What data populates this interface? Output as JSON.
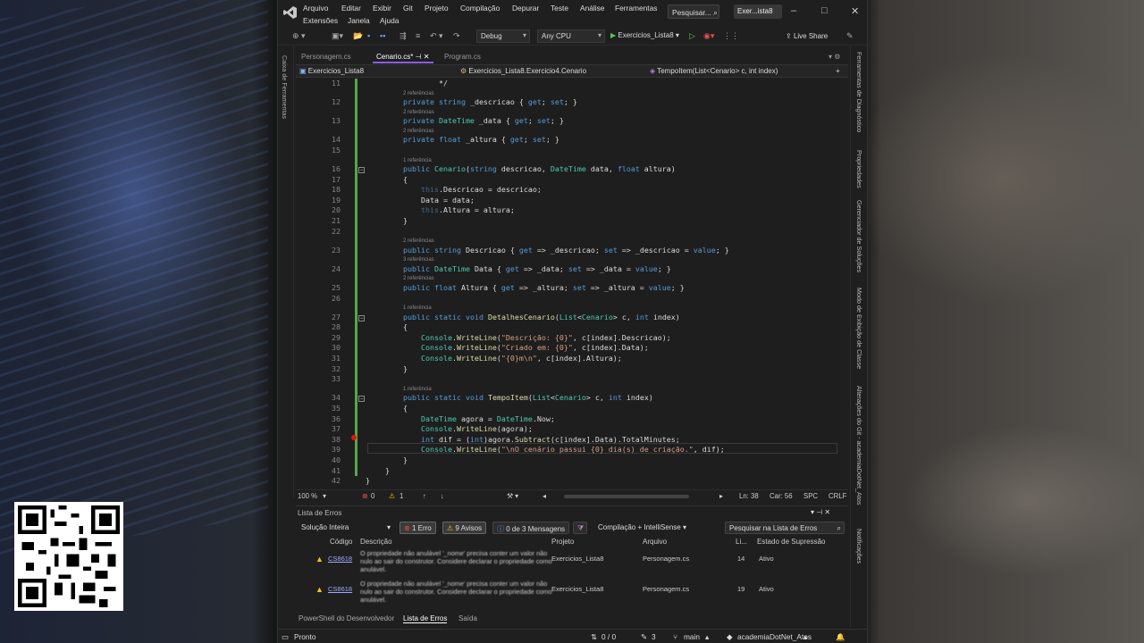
{
  "menu": [
    "Arquivo",
    "Editar",
    "Exibir",
    "Git",
    "Projeto",
    "Compilação",
    "Depurar",
    "Teste",
    "Análise",
    "Ferramentas",
    "Extensões",
    "Janela",
    "Ajuda"
  ],
  "search": {
    "label": "Pesquisar..."
  },
  "project_chip": "Exer...ista8",
  "toolbar": {
    "config": "Debug",
    "platform": "Any CPU",
    "run_label": "Exercicios_Lista8",
    "live_share": "Live Share"
  },
  "tabs": [
    {
      "label": "Personagem.cs"
    },
    {
      "label": "Cenario.cs*"
    },
    {
      "label": "Program.cs"
    }
  ],
  "nav": {
    "project": "Exercicios_Lista8",
    "class": "Exercicios_Lista8.Exercicio4.Cenario",
    "member": "TempoItem(List<Cenario> c, int index)"
  },
  "left_tool": "Caixa de Ferramentas",
  "right_tools": [
    "Ferramentas de Diagnóstico",
    "Propriedades",
    "Gerenciador de Soluções",
    "Modo de Exibição de Classe",
    "Alterações do Git - academiaDotNet_Atos",
    "Notificações"
  ],
  "code": {
    "lines": [
      {
        "n": "11",
        "text": "        */"
      },
      {
        "n": "12",
        "hint": "2 referências",
        "text": "private string _descricao { get; set; }"
      },
      {
        "n": "13",
        "hint": "2 referências",
        "text": "private DateTime _data { get; set; }"
      },
      {
        "n": "14",
        "hint": "2 referências",
        "text": "private float _altura { get; set; }"
      },
      {
        "n": "15",
        "text": ""
      },
      {
        "n": "16",
        "hint": "1 referência",
        "text": "public Cenario(string descricao, DateTime data, float altura)"
      },
      {
        "n": "17",
        "text": "{"
      },
      {
        "n": "18",
        "text": "    this.Descricao = descricao;"
      },
      {
        "n": "19",
        "text": "    Data = data;"
      },
      {
        "n": "20",
        "text": "    this.Altura = altura;"
      },
      {
        "n": "21",
        "text": "}"
      },
      {
        "n": "22",
        "text": ""
      },
      {
        "n": "23",
        "hint": "2 referências",
        "text": "public string Descricao { get => _descricao; set => _descricao = value; }"
      },
      {
        "n": "24",
        "hint": "3 referências",
        "text": "public DateTime Data { get => _data; set => _data = value; }"
      },
      {
        "n": "25",
        "hint": "2 referências",
        "text": "public float Altura { get => _altura; set => _altura = value; }"
      },
      {
        "n": "26",
        "text": ""
      },
      {
        "n": "27",
        "hint": "1 referência",
        "text": "public static void DetalhesCenario(List<Cenario> c, int index)"
      },
      {
        "n": "28",
        "text": "{"
      },
      {
        "n": "29",
        "text": "    Console.WriteLine(\"Descrição: {0}\", c[index].Descricao);"
      },
      {
        "n": "30",
        "text": "    Console.WriteLine(\"Criado em: {0}\", c[index].Data);"
      },
      {
        "n": "31",
        "text": "    Console.WriteLine(\"{0}m\\n\", c[index].Altura);"
      },
      {
        "n": "32",
        "text": "}"
      },
      {
        "n": "33",
        "text": ""
      },
      {
        "n": "34",
        "hint": "1 referência",
        "text": "public static void TempoItem(List<Cenario> c, int index)"
      },
      {
        "n": "35",
        "text": "{"
      },
      {
        "n": "36",
        "text": "    DateTime agora = DateTime.Now;"
      },
      {
        "n": "37",
        "text": "    Console.WriteLine(agora);"
      },
      {
        "n": "38",
        "text": "    int dif = (int)agora.Subtract(c[index].Data).TotalMinutes;"
      },
      {
        "n": "39",
        "text": "    Console.WriteLine(\"\\nO cenário passui {0} dia(s) de criação.\", dif);"
      },
      {
        "n": "40",
        "text": "}"
      },
      {
        "n": "41",
        "text": "}"
      },
      {
        "n": "42",
        "text": "}"
      }
    ]
  },
  "editor_status": {
    "zoom": "100 %",
    "errors": "0",
    "warnings": "1",
    "line": "Ln: 38",
    "col": "Car: 56",
    "spc": "SPC",
    "crlf": "CRLF"
  },
  "errpanel": {
    "title": "Lista de Erros",
    "scope": "Solução Inteira",
    "errors": "1 Erro",
    "warnings": "9 Avisos",
    "messages": "0 de 3 Mensagens",
    "build": "Compilação + IntelliSense",
    "search": "Pesquisar na Lista de Erros",
    "columns": [
      "Código",
      "Descrição",
      "Projeto",
      "Arquivo",
      "Li...",
      "Estado de Supressão"
    ],
    "rows": [
      {
        "code": "CS8618",
        "desc": "O propriedade não anulável '_nome' precisa conter um valor não nulo ao sair do construtor. Considere declarar o propriedade como anulável.",
        "project": "Exercicios_Lista8",
        "file": "Personagem.cs",
        "line": "14",
        "state": "Ativo"
      },
      {
        "code": "CS8618",
        "desc": "O propriedade não anulável '_nome' precisa conter um valor não nulo ao sair do construtor. Considere declarar o propriedade como anulável.",
        "project": "Exercicios_Lista8",
        "file": "Personagem.cs",
        "line": "19",
        "state": "Ativo"
      }
    ]
  },
  "bottom_tabs": [
    "PowerShell do Desenvolvedor",
    "Lista de Erros",
    "Saída"
  ],
  "status": {
    "ready": "Pronto",
    "sync": "0 / 0",
    "pencil": "3",
    "branch": "main",
    "repo": "academiaDotNet_Atos"
  }
}
